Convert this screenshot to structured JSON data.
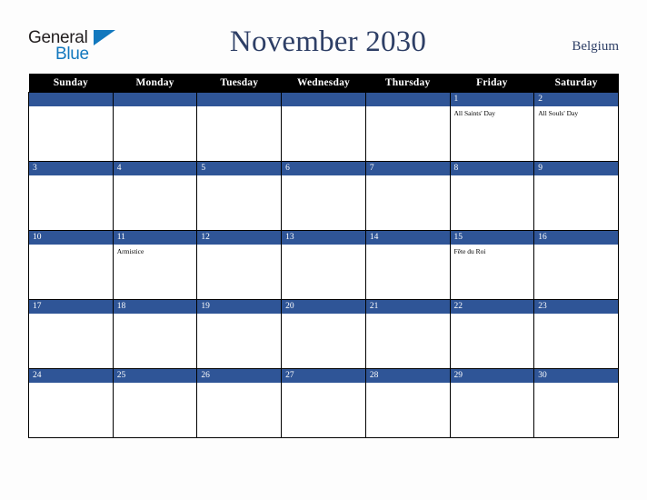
{
  "brand": {
    "name_part1": "General",
    "name_part2": "Blue",
    "triangle_icon": "blue-triangle-icon"
  },
  "header": {
    "title": "November 2030",
    "region": "Belgium"
  },
  "colors": {
    "header_bar": "#000000",
    "date_band": "#2f5597",
    "title_text": "#2e3f66",
    "brand_blue": "#1278be",
    "page_background": "#fdfdfd",
    "cell_background": "#ffffff",
    "grid_border": "#000000"
  },
  "weekdays": [
    "Sunday",
    "Monday",
    "Tuesday",
    "Wednesday",
    "Thursday",
    "Friday",
    "Saturday"
  ],
  "weeks": [
    [
      {
        "day": "",
        "events": []
      },
      {
        "day": "",
        "events": []
      },
      {
        "day": "",
        "events": []
      },
      {
        "day": "",
        "events": []
      },
      {
        "day": "",
        "events": []
      },
      {
        "day": "1",
        "events": [
          "All Saints' Day"
        ]
      },
      {
        "day": "2",
        "events": [
          "All Souls' Day"
        ]
      }
    ],
    [
      {
        "day": "3",
        "events": []
      },
      {
        "day": "4",
        "events": []
      },
      {
        "day": "5",
        "events": []
      },
      {
        "day": "6",
        "events": []
      },
      {
        "day": "7",
        "events": []
      },
      {
        "day": "8",
        "events": []
      },
      {
        "day": "9",
        "events": []
      }
    ],
    [
      {
        "day": "10",
        "events": []
      },
      {
        "day": "11",
        "events": [
          "Armistice"
        ]
      },
      {
        "day": "12",
        "events": []
      },
      {
        "day": "13",
        "events": []
      },
      {
        "day": "14",
        "events": []
      },
      {
        "day": "15",
        "events": [
          "Fête du Roi"
        ]
      },
      {
        "day": "16",
        "events": []
      }
    ],
    [
      {
        "day": "17",
        "events": []
      },
      {
        "day": "18",
        "events": []
      },
      {
        "day": "19",
        "events": []
      },
      {
        "day": "20",
        "events": []
      },
      {
        "day": "21",
        "events": []
      },
      {
        "day": "22",
        "events": []
      },
      {
        "day": "23",
        "events": []
      }
    ],
    [
      {
        "day": "24",
        "events": []
      },
      {
        "day": "25",
        "events": []
      },
      {
        "day": "26",
        "events": []
      },
      {
        "day": "27",
        "events": []
      },
      {
        "day": "28",
        "events": []
      },
      {
        "day": "29",
        "events": []
      },
      {
        "day": "30",
        "events": []
      }
    ]
  ]
}
